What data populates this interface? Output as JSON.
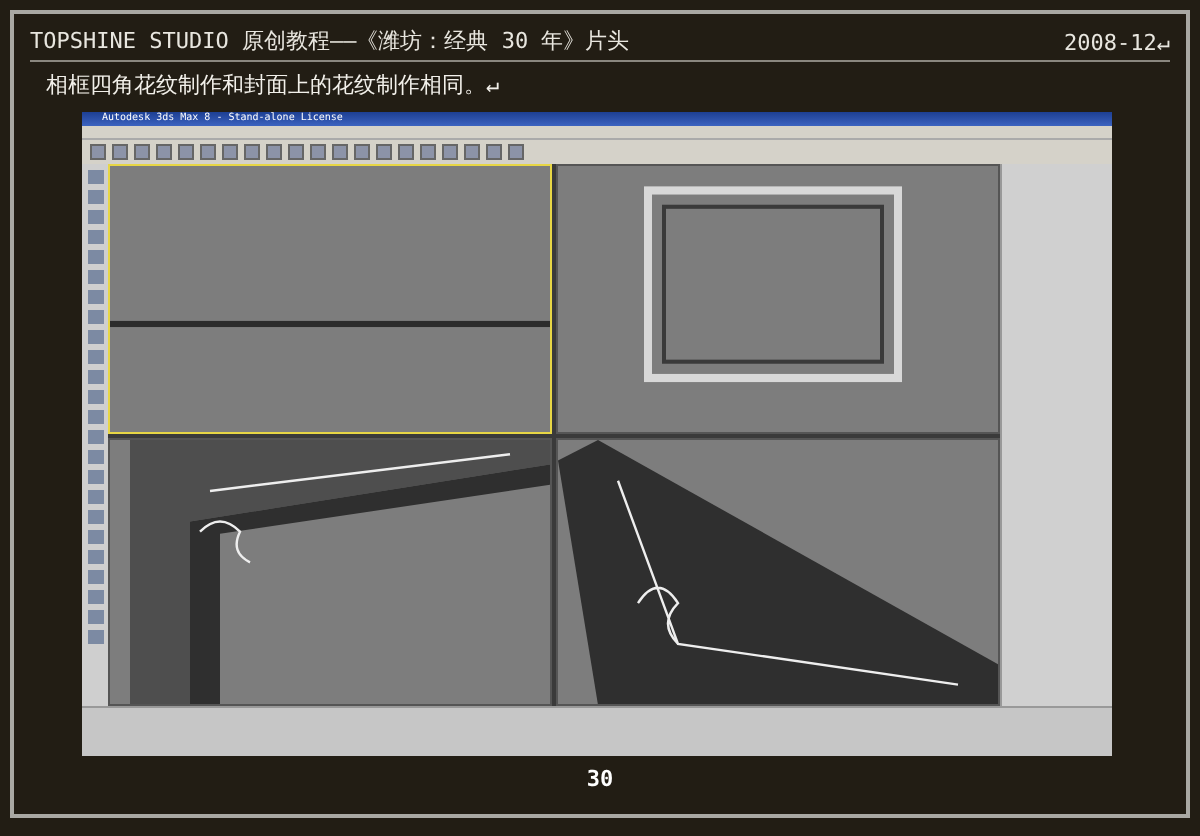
{
  "header": {
    "title": "TOPSHINE STUDIO 原创教程——《潍坊：经典 30 年》片头",
    "date": "2008-12↵"
  },
  "caption": "相框四角花纹制作和封面上的花纹制作相同。↵",
  "app_window": {
    "title": "Autodesk 3ds Max 8 - Stand-alone License",
    "viewports": [
      {
        "kind": "edge",
        "selected": true
      },
      {
        "kind": "frame",
        "selected": false
      },
      {
        "kind": "corner_left",
        "selected": false
      },
      {
        "kind": "corner_right",
        "selected": false
      }
    ]
  },
  "page_number": "30"
}
